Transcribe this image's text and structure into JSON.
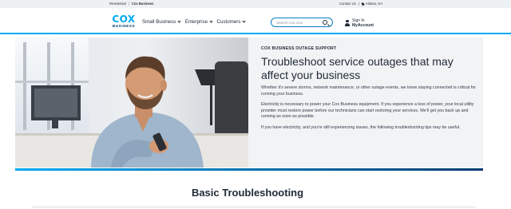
{
  "utility": {
    "residential": "Residential",
    "separator": "|",
    "cox_business": "Cox Business",
    "contact_us": "Contact Us",
    "location": "Atlanta, GA"
  },
  "header": {
    "logo_cox": "COX",
    "logo_business": "BUSINESS",
    "nav": [
      {
        "label": "Small Business"
      },
      {
        "label": "Enterprise"
      },
      {
        "label": "Customers"
      }
    ],
    "search_placeholder": "Search Cox.com",
    "sign_in": "Sign In",
    "my_account": "MyAccount",
    "accent_color": "#00aaf0"
  },
  "hero": {
    "eyebrow": "COX BUSINESS OUTAGE SUPPORT",
    "title": "Troubleshoot service outages that may affect your business",
    "paragraphs": [
      "Whether it's severe storms, network maintenance, or other outage events, we know staying connected is critical for running your business.",
      "Electricity is necessary to power your Cox Business equipment. If you experience a loss of power, your local utility provider must restore power before our technicians can start restoring your services. We'll get you back up and running as soon as possible.",
      "If you have electricity, and you're still experiencing issues, the following troubleshooting tips may be useful."
    ]
  },
  "section": {
    "title": "Basic Troubleshooting"
  }
}
